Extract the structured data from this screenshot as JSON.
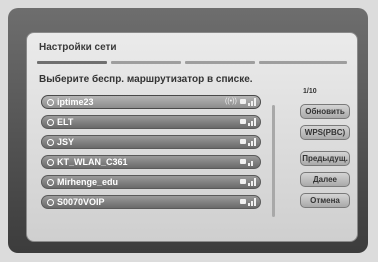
{
  "dialog": {
    "title": "Настройки сети",
    "instruction": "Выберите беспр. маршрутизатор в списке.",
    "page_counter": "1/10"
  },
  "networks": [
    {
      "name": "iptime23",
      "selected": true,
      "wps": true
    },
    {
      "name": "ELT",
      "selected": false,
      "wps": false
    },
    {
      "name": "JSY",
      "selected": false,
      "wps": false
    },
    {
      "name": "KT_WLAN_C361",
      "selected": false,
      "wps": false
    },
    {
      "name": "Mirhenge_edu",
      "selected": false,
      "wps": false
    },
    {
      "name": "S0070VOIP",
      "selected": false,
      "wps": false
    }
  ],
  "buttons": {
    "refresh": "Обновить",
    "wps": "WPS(PBC)",
    "previous": "Предыдущ.",
    "next": "Далее",
    "cancel": "Отмена"
  },
  "icons": {
    "radio": "radio-icon",
    "lock": "lock-icon",
    "signal": "signal-icon",
    "wps": "wps-icon"
  }
}
